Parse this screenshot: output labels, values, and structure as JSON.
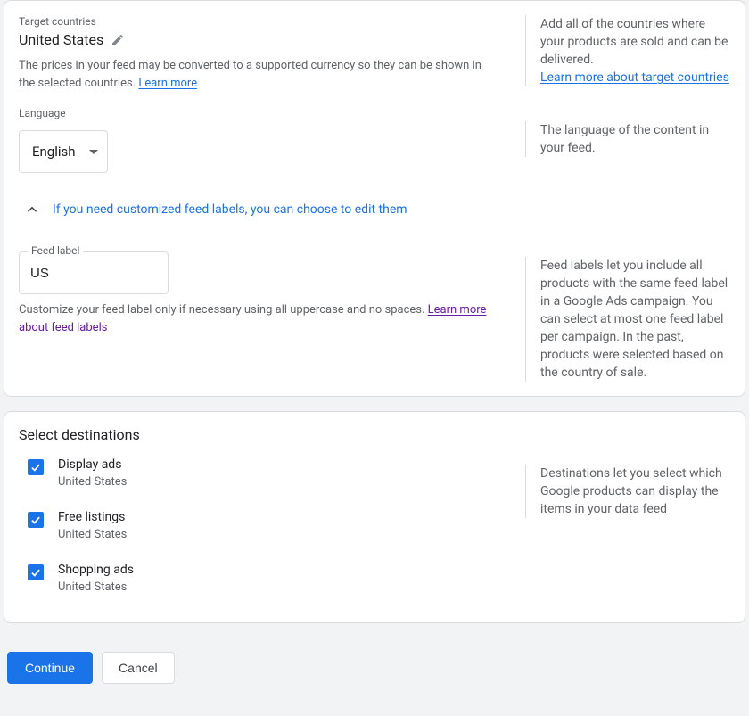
{
  "target": {
    "label": "Target countries",
    "country": "United States",
    "help_prefix": "The prices in your feed may be converted to a supported currency so they can be shown in the selected countries. ",
    "help_link": "Learn more",
    "side_text": "Add all of the countries where your products are sold and can be delivered.",
    "side_link": "Learn more about target countries"
  },
  "language": {
    "label": "Language",
    "value": "English",
    "side_text": "The language of the content in your feed."
  },
  "feedlabel": {
    "expander": "If you need customized feed labels, you can choose to edit them",
    "input_label": "Feed label",
    "value": "US",
    "help_prefix": "Customize your feed label only if necessary using all uppercase and no spaces. ",
    "help_link": "Learn more about feed labels",
    "side_text": "Feed labels let you include all products with the same feed label in a Google Ads campaign. You can select at most one feed label per campaign. In the past, products were selected based on the country of sale."
  },
  "destinations": {
    "title": "Select destinations",
    "side_text": "Destinations let you select which Google products can display the items in your data feed",
    "items": [
      {
        "label": "Display ads",
        "sub": "United States",
        "checked": true
      },
      {
        "label": "Free listings",
        "sub": "United States",
        "checked": true
      },
      {
        "label": "Shopping ads",
        "sub": "United States",
        "checked": true
      }
    ]
  },
  "actions": {
    "continue": "Continue",
    "cancel": "Cancel"
  }
}
